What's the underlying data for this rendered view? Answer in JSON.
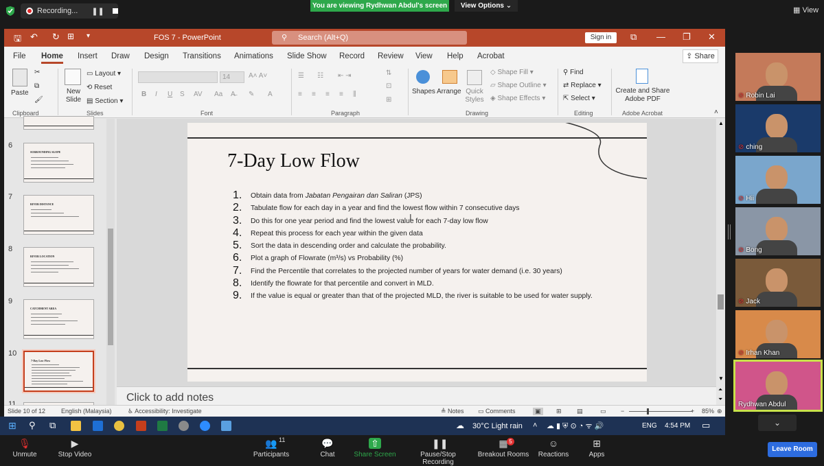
{
  "zoom": {
    "recording_label": "Recording...",
    "viewing_banner": "You are viewing Rydhwan Abdul's screen",
    "view_options": "View Options",
    "view_button": "View",
    "leave_room": "Leave Room",
    "toolbar": [
      {
        "label": "Unmute",
        "icon": "mic-muted-icon"
      },
      {
        "label": "Stop Video",
        "icon": "video-icon"
      },
      {
        "label": "Participants",
        "icon": "participants-icon",
        "count": "11"
      },
      {
        "label": "Chat",
        "icon": "chat-icon"
      },
      {
        "label": "Share Screen",
        "icon": "share-screen-icon"
      },
      {
        "label": "Pause/Stop Recording",
        "icon": "pause-stop-icon"
      },
      {
        "label": "Breakout Rooms",
        "icon": "breakout-icon",
        "badge": "5"
      },
      {
        "label": "Reactions",
        "icon": "reactions-icon"
      },
      {
        "label": "Apps",
        "icon": "apps-icon"
      }
    ],
    "participants": [
      {
        "name": "Robin Lai",
        "bg": "#c47a5a"
      },
      {
        "name": "ching",
        "bg": "#1a3a6a"
      },
      {
        "name": "Hii",
        "bg": "#7aa6cc"
      },
      {
        "name": "Bong",
        "bg": "#8a96a6"
      },
      {
        "name": "Jack",
        "bg": "#7a5a3a"
      },
      {
        "name": "Irhan Khan",
        "bg": "#d88a4a"
      },
      {
        "name": "Rydhwan Abdul",
        "bg": "#d0558a"
      }
    ]
  },
  "ppt": {
    "title": "FOS 7  -  PowerPoint",
    "search_placeholder": "Search (Alt+Q)",
    "sign_in": "Sign in",
    "share": "Share",
    "tabs": [
      "File",
      "Home",
      "Insert",
      "Draw",
      "Design",
      "Transitions",
      "Animations",
      "Slide Show",
      "Record",
      "Review",
      "View",
      "Help",
      "Acrobat"
    ],
    "ribbon": {
      "paste": "Paste",
      "clipboard": "Clipboard",
      "new_slide": "New Slide",
      "layout": "Layout",
      "reset": "Reset",
      "section": "Section",
      "slides": "Slides",
      "font_size": "14",
      "font": "Font",
      "paragraph": "Paragraph",
      "shapes": "Shapes",
      "arrange": "Arrange",
      "quick_styles": "Quick Styles",
      "shape_fill": "Shape Fill",
      "shape_outline": "Shape Outline",
      "shape_effects": "Shape Effects",
      "drawing": "Drawing",
      "find": "Find",
      "replace": "Replace",
      "select": "Select",
      "editing": "Editing",
      "create_share_pdf": "Create and Share Adobe PDF",
      "adobe_acrobat": "Adobe Acrobat"
    },
    "thumbnails": [
      {
        "num": "6",
        "title": "SURROUNDING SLOPE"
      },
      {
        "num": "7",
        "title": "RIVER DISTANCE"
      },
      {
        "num": "8",
        "title": "RIVER LOCATION"
      },
      {
        "num": "9",
        "title": "CATCHMENT AREA"
      },
      {
        "num": "10",
        "title": "7-Day Low Flow"
      },
      {
        "num": "11",
        "title": ""
      }
    ],
    "slide": {
      "title": "7-Day Low Flow",
      "steps": [
        {
          "n": "1.",
          "text": "Obtain data from ",
          "italic": "Jabatan Pengairan dan Saliran",
          "after": " (JPS)"
        },
        {
          "n": "2.",
          "text": "Tabulate flow for each day in a year and find the lowest flow within 7 consecutive days"
        },
        {
          "n": "3.",
          "text": "Do this for one year period and find the lowest value for each 7-day low flow"
        },
        {
          "n": "4.",
          "text": "Repeat this process for each year within the given data"
        },
        {
          "n": "5.",
          "text": "Sort the data in descending order and calculate the probability."
        },
        {
          "n": "6.",
          "text": "Plot a graph of Flowrate (m³/s) vs Probability (%)"
        },
        {
          "n": "7.",
          "text": "Find the Percentile that correlates to the projected number of years for water demand (i.e. 30 years)"
        },
        {
          "n": "8.",
          "text": "Identify the flowrate for that percentile and convert in MLD."
        },
        {
          "n": "9.",
          "text": "If the value is equal or greater than that of the projected MLD, the river is suitable to be used for water supply."
        }
      ]
    },
    "notes_placeholder": "Click to add notes",
    "status": {
      "slide_of": "Slide 10 of 12",
      "language": "English (Malaysia)",
      "accessibility": "Accessibility: Investigate",
      "notes": "Notes",
      "comments": "Comments",
      "zoom": "85%"
    }
  },
  "taskbar": {
    "weather": "30°C  Light rain",
    "lang": "ENG",
    "time": "4:54 PM"
  }
}
